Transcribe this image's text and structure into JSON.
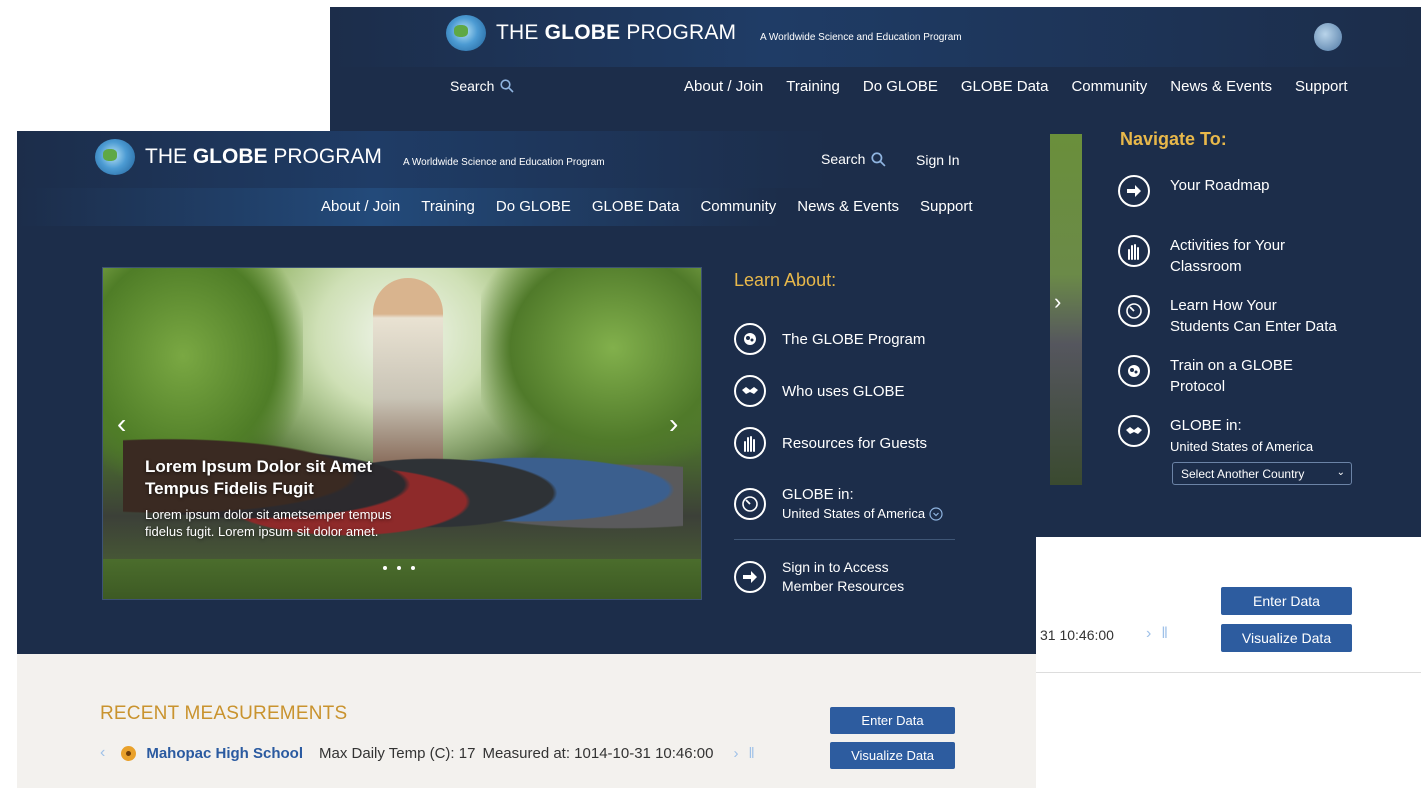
{
  "brand": {
    "name_prefix": "THE ",
    "name_bold": "GLOBE",
    "name_suffix": " PROGRAM",
    "tagline": "A Worldwide Science and Education Program"
  },
  "nav": {
    "search_label": "Search",
    "sign_in": "Sign In",
    "items": [
      "About / Join",
      "Training",
      "Do GLOBE",
      "GLOBE Data",
      "Community",
      "News & Events",
      "Support"
    ]
  },
  "hero": {
    "headline": "Lorem Ipsum Dolor sit Amet Tempus Fidelis Fugit",
    "body": "Lorem ipsum dolor sit ametsemper tempus fidelus fugit.  Lorem ipsum sit dolor amet."
  },
  "learn_about": {
    "title": "Learn About:",
    "items": [
      {
        "label": "The GLOBE Program",
        "icon": "brain-icon"
      },
      {
        "label": "Who uses GLOBE",
        "icon": "handshake-icon"
      },
      {
        "label": "Resources for Guests",
        "icon": "hands-icon"
      },
      {
        "label": "GLOBE in:",
        "sub": "United States of America",
        "icon": "compass-icon"
      }
    ],
    "sign_in_line1": "Sign in to Access",
    "sign_in_line2": "Member Resources"
  },
  "recent": {
    "title": "RECENT MEASUREMENTS",
    "school": "Mahopac High School",
    "measurement": "Max Daily Temp (C): 17",
    "measured_at": "Measured at: 1014-10-31  10:46:00",
    "enter_data": "Enter Data",
    "visualize_data": "Visualize Data"
  },
  "back": {
    "navigate_title": "Navigate To:",
    "items": [
      {
        "line1": "Your Roadmap",
        "line2": "",
        "icon": "arrow-right-icon"
      },
      {
        "line1": "Activities for Your",
        "line2": "Classroom",
        "icon": "hands-icon"
      },
      {
        "line1": "Learn How Your",
        "line2": "Students Can Enter Data",
        "icon": "compass-icon"
      },
      {
        "line1": "Train on a GLOBE",
        "line2": "Protocol",
        "icon": "brain-icon"
      },
      {
        "line1": "GLOBE in:",
        "line2": "United States of America",
        "icon": "handshake-icon"
      }
    ],
    "select_label": "Select Another Country",
    "timestamp_fragment": "31  10:46:00"
  },
  "colors": {
    "navy": "#1c2d4a",
    "gold": "#e8b84a",
    "button_blue": "#2d5c9f",
    "link_blue": "#2a5aa0",
    "marker_orange": "#e9a12b"
  }
}
